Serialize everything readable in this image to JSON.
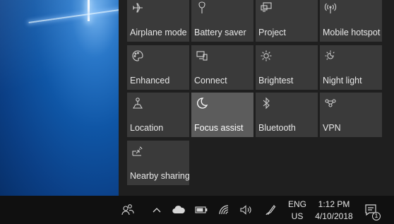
{
  "tiles": [
    {
      "label": "Airplane mode",
      "icon": "airplane-icon",
      "active": false
    },
    {
      "label": "Battery saver",
      "icon": "battery-saver-icon",
      "active": false
    },
    {
      "label": "Project",
      "icon": "project-icon",
      "active": false
    },
    {
      "label": "Mobile hotspot",
      "icon": "mobile-hotspot-icon",
      "active": false
    },
    {
      "label": "Enhanced",
      "icon": "palette-icon",
      "active": false
    },
    {
      "label": "Connect",
      "icon": "connect-icon",
      "active": false
    },
    {
      "label": "Brightest",
      "icon": "brightness-icon",
      "active": false
    },
    {
      "label": "Night light",
      "icon": "night-light-icon",
      "active": false
    },
    {
      "label": "Location",
      "icon": "location-icon",
      "active": false
    },
    {
      "label": "Focus assist",
      "icon": "moon-icon",
      "active": true
    },
    {
      "label": "Bluetooth",
      "icon": "bluetooth-icon",
      "active": false
    },
    {
      "label": "VPN",
      "icon": "vpn-icon",
      "active": false
    },
    {
      "label": "Nearby sharing",
      "icon": "nearby-sharing-icon",
      "active": false
    }
  ],
  "taskbar": {
    "language_line1": "ENG",
    "language_line2": "US",
    "time": "1:12 PM",
    "date": "4/10/2018",
    "notification_count": "1"
  },
  "colors": {
    "tile": "#3a3a3a",
    "tile_active": "#5c5c5c",
    "panel": "#1f1f1f",
    "taskbar": "#101010"
  }
}
